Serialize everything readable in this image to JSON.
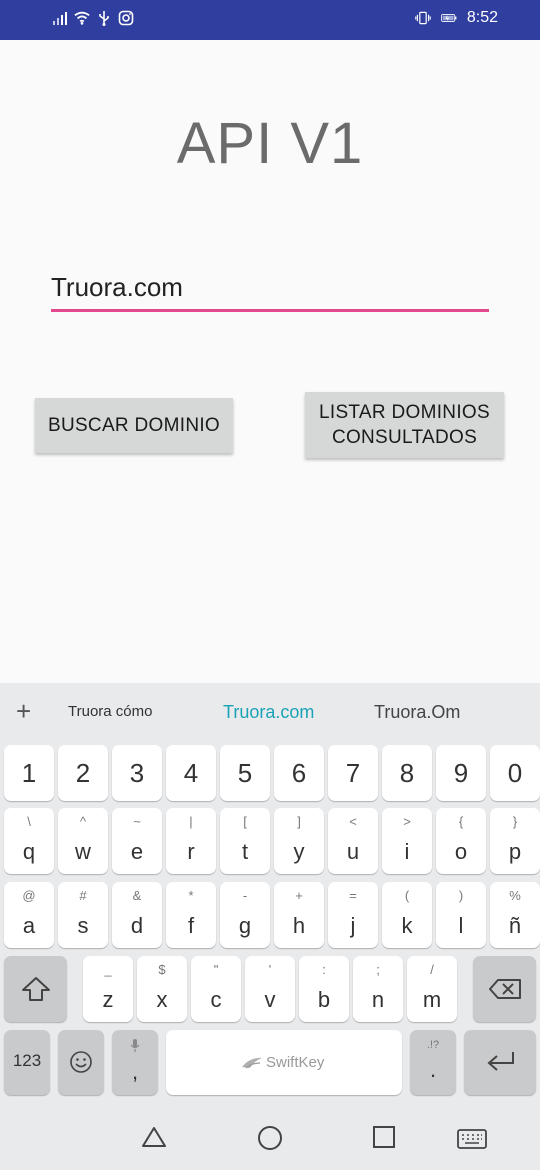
{
  "status_bar": {
    "time": "8:52"
  },
  "app": {
    "title": "API V1",
    "domain_input_value": "Truora.com",
    "buscar_button": "BUSCAR DOMINIO",
    "listar_button_line1": "LISTAR DOMINIOS",
    "listar_button_line2": "CONSULTADOS"
  },
  "keyboard": {
    "suggestions": [
      "Truora cómo",
      "Truora.com",
      "Truora.Om"
    ],
    "number_row": [
      "1",
      "2",
      "3",
      "4",
      "5",
      "6",
      "7",
      "8",
      "9",
      "0"
    ],
    "row1": [
      {
        "main": "q",
        "alt": "\\"
      },
      {
        "main": "w",
        "alt": "^"
      },
      {
        "main": "e",
        "alt": "~"
      },
      {
        "main": "r",
        "alt": "|"
      },
      {
        "main": "t",
        "alt": "["
      },
      {
        "main": "y",
        "alt": "]"
      },
      {
        "main": "u",
        "alt": "<"
      },
      {
        "main": "i",
        "alt": ">"
      },
      {
        "main": "o",
        "alt": "{"
      },
      {
        "main": "p",
        "alt": "}"
      }
    ],
    "row2": [
      {
        "main": "a",
        "alt": "@"
      },
      {
        "main": "s",
        "alt": "#"
      },
      {
        "main": "d",
        "alt": "&"
      },
      {
        "main": "f",
        "alt": "*"
      },
      {
        "main": "g",
        "alt": "-"
      },
      {
        "main": "h",
        "alt": "+"
      },
      {
        "main": "j",
        "alt": "="
      },
      {
        "main": "k",
        "alt": "("
      },
      {
        "main": "l",
        "alt": ")"
      },
      {
        "main": "ñ",
        "alt": "%"
      }
    ],
    "row3": [
      {
        "main": "z",
        "alt": "_"
      },
      {
        "main": "x",
        "alt": "$"
      },
      {
        "main": "c",
        "alt": "\""
      },
      {
        "main": "v",
        "alt": "'"
      },
      {
        "main": "b",
        "alt": ":"
      },
      {
        "main": "n",
        "alt": ";"
      },
      {
        "main": "m",
        "alt": "/"
      }
    ],
    "symbols_key": "123",
    "comma_key": ",",
    "period_key": ".",
    "period_alt": ".!?",
    "space_brand": "SwiftKey"
  }
}
